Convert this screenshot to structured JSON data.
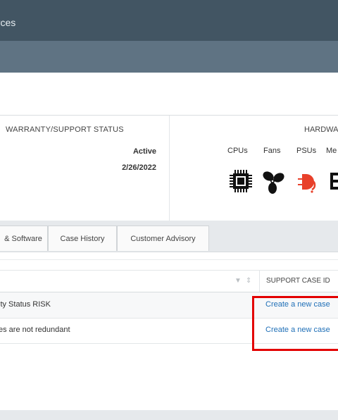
{
  "topbar": {
    "nav_label": "urces"
  },
  "warranty": {
    "title": "WARRANTY/SUPPORT STATUS",
    "status": "Active",
    "date": "2/26/2022"
  },
  "hardware": {
    "title": "HARDWAR",
    "columns": [
      {
        "label": "CPUs",
        "icon": "cpu-icon"
      },
      {
        "label": "Fans",
        "icon": "fan-icon"
      },
      {
        "label": "PSUs",
        "icon": "power-supply-icon",
        "color": "#e8402a"
      },
      {
        "label": "Me",
        "icon": "memory-icon"
      }
    ]
  },
  "tabs": [
    "& Software",
    "Case History",
    "Customer Advisory"
  ],
  "table": {
    "case_header": "SUPPORT CASE ID",
    "rows": [
      {
        "text": "ity Status RISK",
        "link": "Create a new case"
      },
      {
        "text": "es are not redundant",
        "link": "Create a new case"
      }
    ]
  },
  "colors": {
    "header": "#425563",
    "subheader": "#5f7383",
    "link": "#1f6fb7",
    "highlight": "#e30000"
  }
}
